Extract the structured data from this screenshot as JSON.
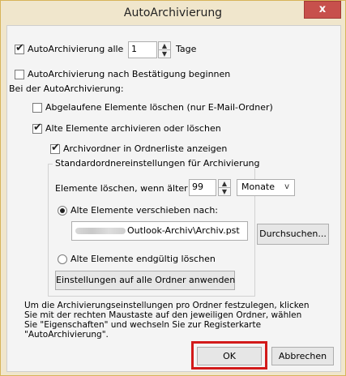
{
  "dialog": {
    "title": "AutoArchivierung",
    "close_glyph": "x"
  },
  "top": {
    "autoarchive_every": {
      "label": "AutoArchivierung alle",
      "checked": true,
      "value": "1",
      "unit": "Tage"
    },
    "ask_before": {
      "label": "AutoArchivierung nach Bestätigung beginnen",
      "checked": false
    },
    "section_label": "Bei der AutoArchivierung:",
    "delete_expired": {
      "label": "Abgelaufene Elemente löschen (nur E-Mail-Ordner)",
      "checked": false
    },
    "archive_old": {
      "label": "Alte Elemente archivieren oder löschen",
      "checked": true
    },
    "show_folder": {
      "label": "Archivordner in Ordnerliste anzeigen",
      "checked": true
    }
  },
  "group": {
    "title": "Standardordnereinstellungen für Archivierung",
    "clean_older": {
      "label": "Elemente löschen, wenn älter als",
      "value": "99",
      "unit": "Monate"
    },
    "move_old": {
      "label": "Alte Elemente verschieben nach:",
      "selected": true
    },
    "path": {
      "value": "Outlook-Archiv\\Archiv.pst"
    },
    "browse_label": "Durchsuchen...",
    "delete_permanently": {
      "label": "Alte Elemente endgültig löschen",
      "selected": false
    },
    "apply_all_label": "Einstellungen auf alle Ordner anwenden"
  },
  "info_text": "Um die Archivierungseinstellungen pro Ordner festzulegen, klicken\nSie mit der rechten Maustaste auf den jeweiligen Ordner, wählen\nSie \"Eigenschaften\" und wechseln Sie zur Registerkarte\n\"AutoArchivierung\".",
  "footer": {
    "ok_label": "OK",
    "cancel_label": "Abbrechen"
  },
  "colors": {
    "highlight": "#d21a1a",
    "close_button": "#c7504c",
    "title_bar": "#f0e6cc"
  }
}
